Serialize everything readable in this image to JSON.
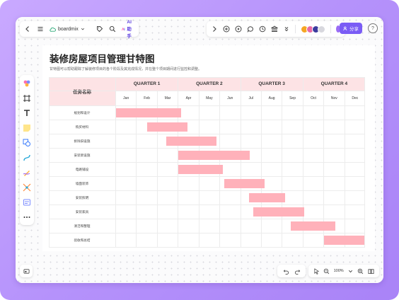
{
  "app": {
    "brand_name": "boardmix",
    "ai_label": "AI助手",
    "share_label": "分享",
    "help_label": "?",
    "zoom_level": "100%",
    "accent_color": "#7a5cf5"
  },
  "document": {
    "title": "装修房屋项目管理甘特图",
    "subtitle": "甘特图可以帮助跟踪了解装修项目的各个阶段及其完成情况，并在整个项目期间进行监控和调整。"
  },
  "gantt": {
    "task_header": "任务名称",
    "bar_color": "#ffb1ba",
    "header_color": "#fde3e5",
    "quarters": [
      "QUARTER 1",
      "QUARTER 2",
      "QUARTER 3",
      "QUARTER 4"
    ],
    "months": [
      "Jan",
      "Feb",
      "Mar",
      "Apr",
      "May",
      "Jun",
      "Jul",
      "Aug",
      "Sep",
      "Oct",
      "Nov",
      "Dec"
    ],
    "tasks": [
      {
        "name": "规划和设计",
        "start_month": 1.0,
        "end_month": 3.2
      },
      {
        "name": "购买材料",
        "start_month": 2.5,
        "end_month": 3.5
      },
      {
        "name": "拆除旧设施",
        "start_month": 3.4,
        "end_month": 4.9
      },
      {
        "name": "安装新设施",
        "start_month": 4.0,
        "end_month": 6.5
      },
      {
        "name": "电路铺设",
        "start_month": 4.0,
        "end_month": 5.2
      },
      {
        "name": "墙面装饰",
        "start_month": 6.2,
        "end_month": 7.2
      },
      {
        "name": "安装照明",
        "start_month": 7.4,
        "end_month": 8.2
      },
      {
        "name": "安装家具",
        "start_month": 7.6,
        "end_month": 9.1
      },
      {
        "name": "清洁和整理",
        "start_month": 9.4,
        "end_month": 10.6
      },
      {
        "name": "验收和总结",
        "start_month": 11.0,
        "end_month": 12.0
      }
    ]
  }
}
